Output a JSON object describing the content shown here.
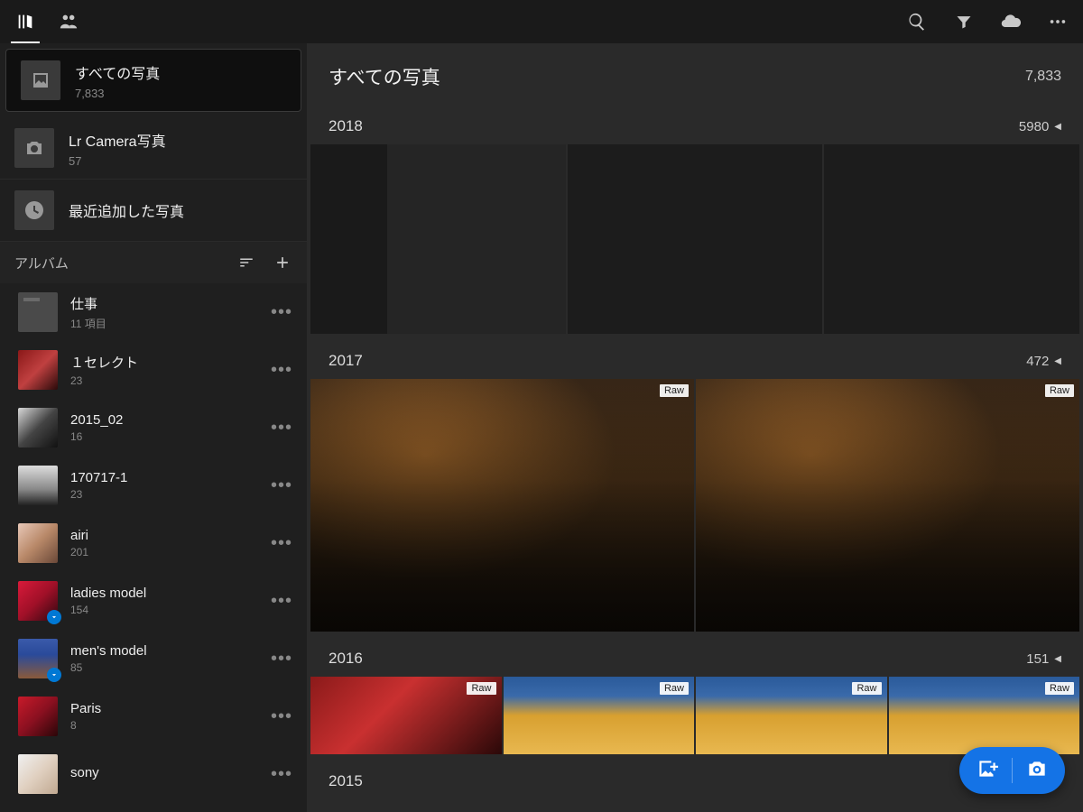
{
  "topbar": {
    "library_icon": "library",
    "people_icon": "people",
    "search_icon": "search",
    "filter_icon": "filter",
    "cloud_icon": "cloud",
    "more_icon": "more"
  },
  "collections": [
    {
      "title": "すべての写真",
      "count": "7,833",
      "icon": "photo",
      "selected": true
    },
    {
      "title": "Lr Camera写真",
      "count": "57",
      "icon": "camera",
      "selected": false
    },
    {
      "title": "最近追加した写真",
      "count": "",
      "icon": "clock",
      "selected": false
    }
  ],
  "albums_header": {
    "label": "アルバム"
  },
  "albums": [
    {
      "title": "仕事",
      "count": "11 項目",
      "type": "folder",
      "sync": false
    },
    {
      "title": "１セレクト",
      "count": "23",
      "type": "album",
      "bg": "bg-select",
      "sync": false
    },
    {
      "title": "2015_02",
      "count": "16",
      "type": "album",
      "bg": "bg-2015",
      "sync": false
    },
    {
      "title": "170717-1",
      "count": "23",
      "type": "album",
      "bg": "bg-17",
      "sync": false
    },
    {
      "title": "airi",
      "count": "201",
      "type": "album",
      "bg": "bg-airi",
      "sync": false
    },
    {
      "title": "ladies model",
      "count": "154",
      "type": "album",
      "bg": "bg-ladies",
      "sync": true
    },
    {
      "title": "men's model",
      "count": "85",
      "type": "album",
      "bg": "bg-mens",
      "sync": true
    },
    {
      "title": "Paris",
      "count": "8",
      "type": "album",
      "bg": "bg-paris",
      "sync": false
    },
    {
      "title": "sony",
      "count": "",
      "type": "album",
      "bg": "bg-sony",
      "sync": false
    }
  ],
  "main": {
    "title": "すべての写真",
    "total": "7,833",
    "raw_badge": "Raw",
    "years": [
      {
        "label": "2018",
        "count": "5980",
        "thumbs": 3,
        "style": "ui"
      },
      {
        "label": "2017",
        "count": "472",
        "thumbs": 2,
        "style": "night",
        "raw": true
      },
      {
        "label": "2016",
        "count": "151",
        "thumbs": 4,
        "style": "autumn",
        "raw": true
      },
      {
        "label": "2015",
        "count": "",
        "thumbs": 0
      }
    ]
  },
  "fab": {
    "add": "add-image",
    "camera": "camera"
  }
}
